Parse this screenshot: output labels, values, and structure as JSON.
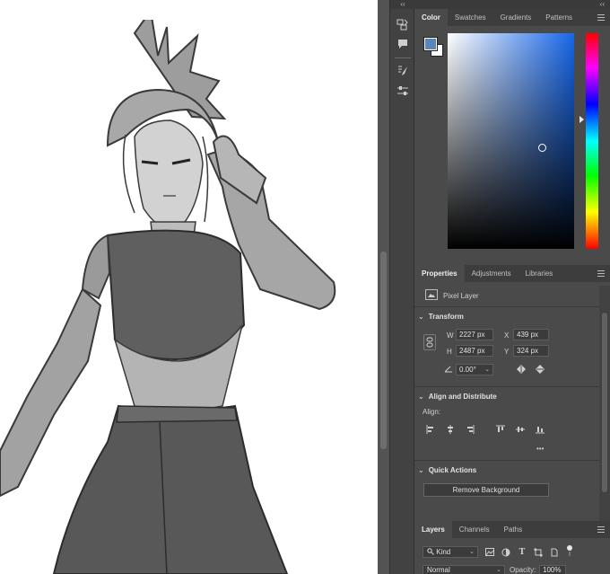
{
  "panel_collapse_glyph": "‹‹",
  "color_panel": {
    "tabs": [
      "Color",
      "Swatches",
      "Gradients",
      "Patterns"
    ],
    "active_tab": 0,
    "foreground_color": "#5a85b8",
    "background_color": "#ffffff",
    "field_hue_color": "#1766e8"
  },
  "properties_panel": {
    "tabs": [
      "Properties",
      "Adjustments",
      "Libraries"
    ],
    "active_tab": 0,
    "layer_type": "Pixel Layer",
    "transform": {
      "heading": "Transform",
      "w_label": "W",
      "w_value": "2227 px",
      "h_label": "H",
      "h_value": "2487 px",
      "x_label": "X",
      "x_value": "439 px",
      "y_label": "Y",
      "y_value": "324 px",
      "angle_value": "0.00°"
    },
    "align": {
      "heading": "Align and Distribute",
      "label": "Align:",
      "more": "•••"
    },
    "quick_actions": {
      "heading": "Quick Actions",
      "button": "Remove Background"
    }
  },
  "layers_panel": {
    "tabs": [
      "Layers",
      "Channels",
      "Paths"
    ],
    "active_tab": 0,
    "filter_value": "Kind",
    "blend_mode": "Normal",
    "opacity_label": "Opacity:",
    "opacity_value": "100%"
  }
}
